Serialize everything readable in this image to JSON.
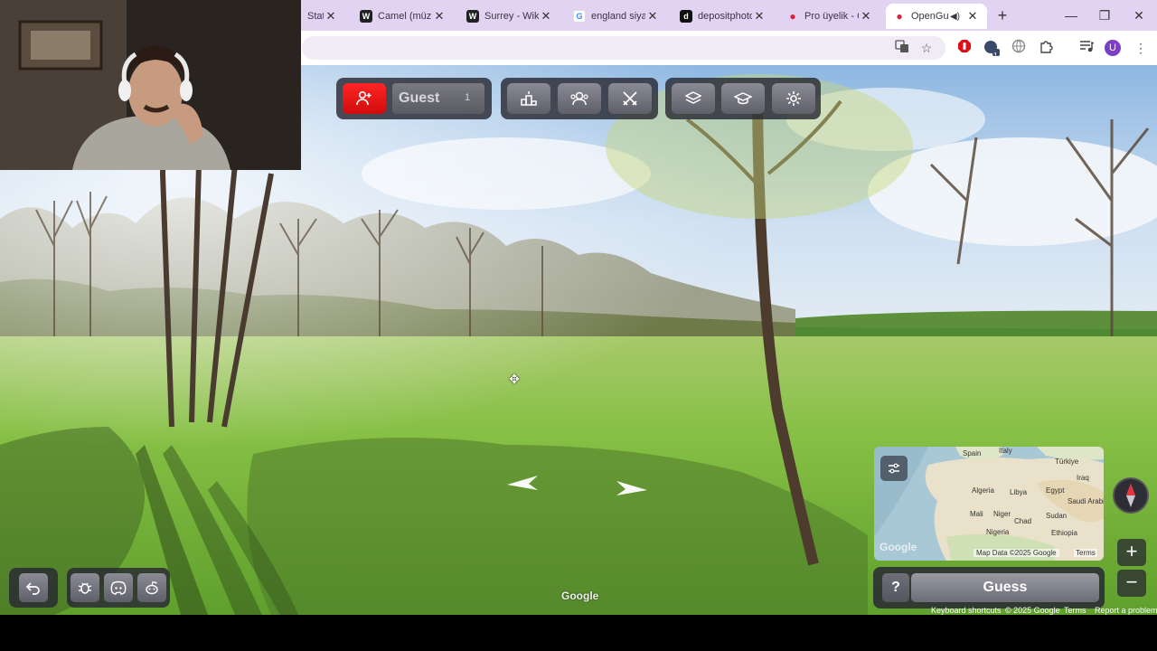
{
  "browser": {
    "tabs": [
      {
        "title": "Stati",
        "favicon": "blank",
        "fav_color": "#e3d3f3",
        "fav_glyph": ""
      },
      {
        "title": "Camel (müzik",
        "favicon": "wikipedia-icon",
        "fav_color": "#202122",
        "fav_glyph": "W"
      },
      {
        "title": "Surrey - Wiki",
        "favicon": "wikipedia-icon",
        "fav_color": "#202122",
        "fav_glyph": "W"
      },
      {
        "title": "england siyas",
        "favicon": "google-icon",
        "fav_color": "#4285f4",
        "fav_glyph": "G"
      },
      {
        "title": "depositphoto",
        "favicon": "depositphotos-icon",
        "fav_color": "#111111",
        "fav_glyph": "d"
      },
      {
        "title": "Pro üyelik - O",
        "favicon": "opengeo-pin-icon",
        "fav_color": "#d9233c",
        "fav_glyph": "●"
      },
      {
        "title": "OpenGu",
        "favicon": "opengeo-pin-icon",
        "fav_color": "#d9233c",
        "fav_glyph": "●",
        "active": true
      }
    ],
    "tab_close": "✕",
    "new_tab": "+",
    "window_controls": {
      "minimize": "—",
      "restore": "❐",
      "close": "✕"
    },
    "profile_initial": "U",
    "extension_badge": "1"
  },
  "game": {
    "player_name": "Guest",
    "player_count": "1",
    "guess_label": "Guess",
    "help_label": "?",
    "zoom_in": "+",
    "zoom_out": "−",
    "watermark": "Google"
  },
  "minimap": {
    "labels": [
      {
        "text": "Spain"
      },
      {
        "text": "Italy"
      },
      {
        "text": "Türkiye"
      },
      {
        "text": "Iraq"
      },
      {
        "text": "Algeria"
      },
      {
        "text": "Libya"
      },
      {
        "text": "Egypt"
      },
      {
        "text": "Saudi Arabia"
      },
      {
        "text": "Mali"
      },
      {
        "text": "Niger"
      },
      {
        "text": "Chad"
      },
      {
        "text": "Sudan"
      },
      {
        "text": "Nigeria"
      },
      {
        "text": "Ethiopia"
      }
    ],
    "data_text": "Map Data ©2025 Google",
    "terms": "Terms",
    "logo": "Google"
  },
  "attribution": {
    "keyboard": "Keyboard shortcuts",
    "copyright": "© 2025 Google",
    "terms": "Terms",
    "report": "Report a problem"
  },
  "colors": {
    "tab_strip": "#e3d3f3",
    "hud_red": "#e81818",
    "hud_panel": "#282832",
    "grass": "#7fbf3a",
    "sky": "#bcd7ef"
  }
}
